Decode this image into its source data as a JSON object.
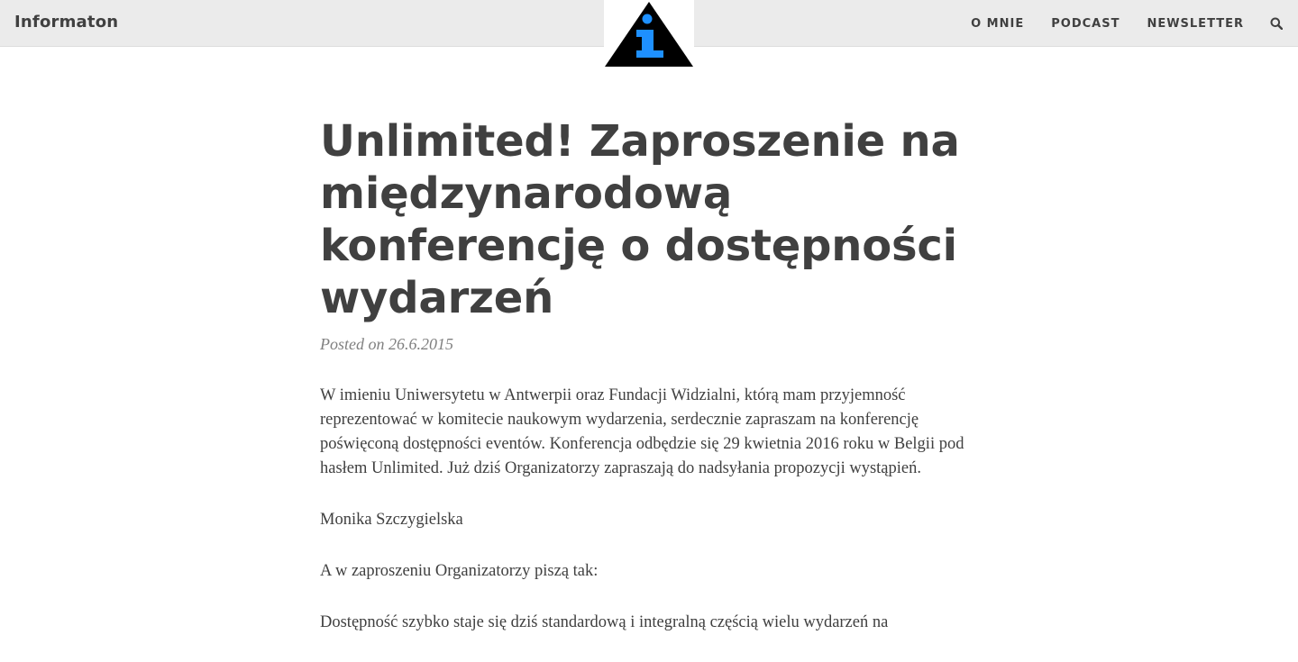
{
  "navbar": {
    "brand": "Informaton",
    "logo_icon": "info-triangle-icon",
    "logo_colors": {
      "triangle": "#000000",
      "letter": "#1e90ff"
    },
    "menu": [
      {
        "label": "O MNIE"
      },
      {
        "label": "PODCAST"
      },
      {
        "label": "NEWSLETTER"
      }
    ],
    "search_icon": "search-icon"
  },
  "post": {
    "title": "Unlimited! Zaproszenie na międzynarodową konferencję o dostępności wydarzeń",
    "meta": "Posted on 26.6.2015",
    "paragraphs": [
      "W imieniu Uniwersytetu w Antwerpii oraz Fundacji Widzialni, którą mam przyjemność reprezentować w komitecie naukowym wydarzenia, serdecznie zapraszam na konferencję poświęconą dostępności eventów. Konferencja odbędzie się 29 kwietnia 2016 roku w Belgii pod hasłem Unlimited. Już dziś Organizatorzy zapraszają do nadsyłania propozycji wystąpień.",
      "Monika Szczygielska",
      "A w zaproszeniu Organizatorzy piszą tak:",
      "Dostępność szybko staje się dziś standardową i integralną częścią wielu wydarzeń na"
    ]
  }
}
